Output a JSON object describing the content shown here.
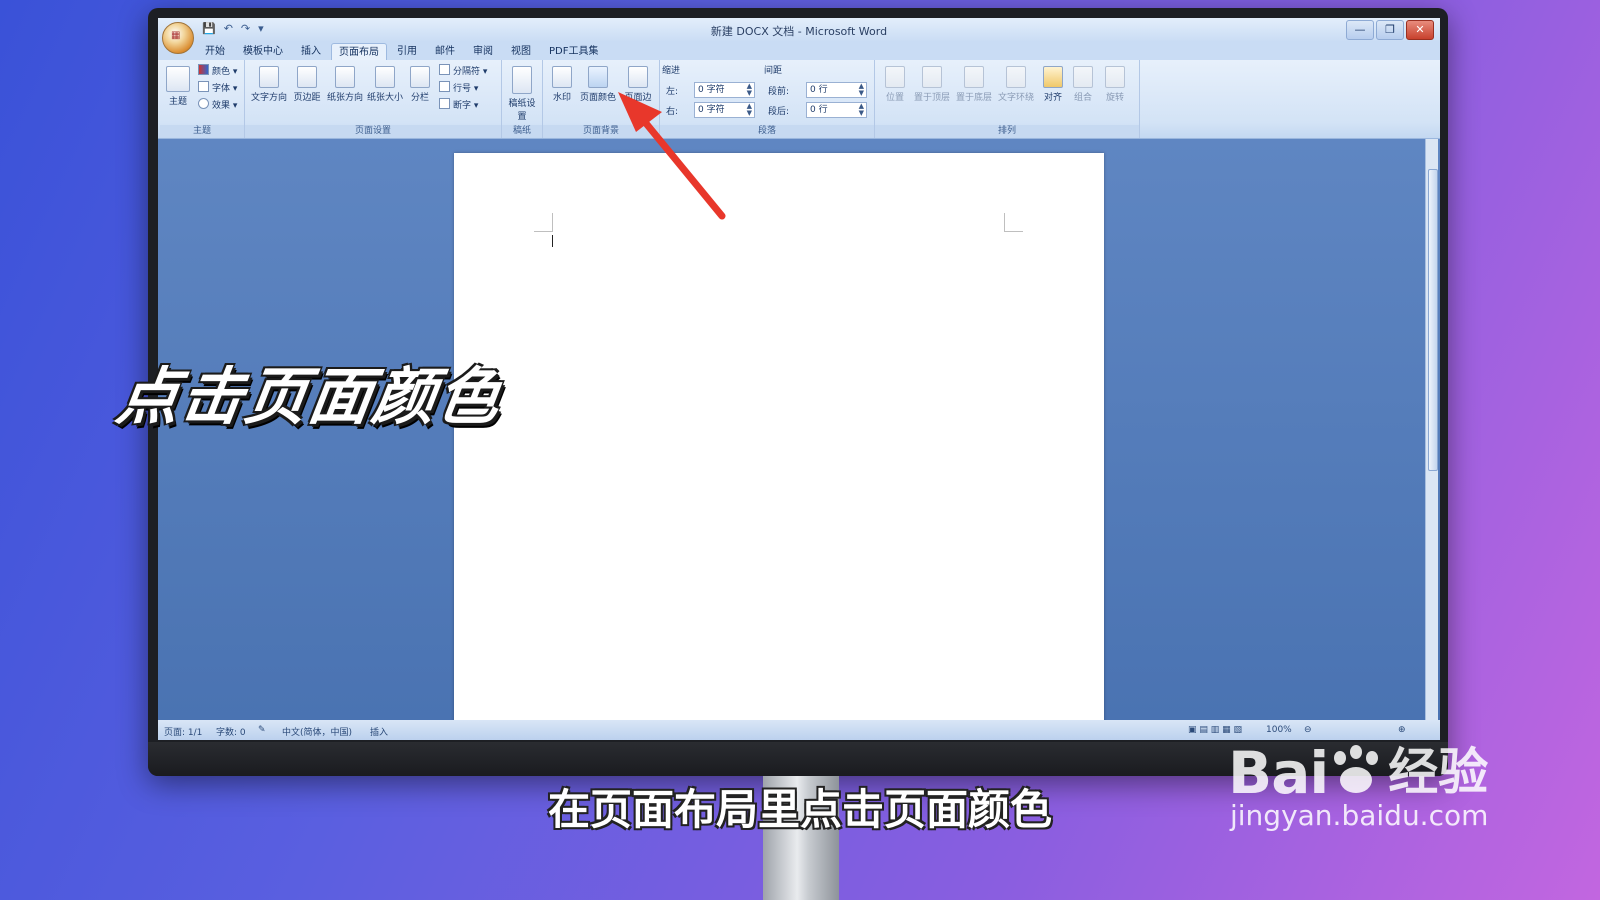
{
  "window": {
    "title": "新建 DOCX 文档 - Microsoft Word",
    "controls": [
      "—",
      "❐",
      "✕"
    ]
  },
  "tabs": [
    "开始",
    "模板中心",
    "插入",
    "页面布局",
    "引用",
    "邮件",
    "审阅",
    "视图",
    "PDF工具集"
  ],
  "active_tab": "页面布局",
  "ribbon": {
    "theme_group": {
      "label": "主题",
      "theme_button": "主题",
      "items": [
        "颜色",
        "字体",
        "效果"
      ]
    },
    "page_setup_group": {
      "label": "页面设置",
      "buttons": [
        "文字方向",
        "页边距",
        "纸张方向",
        "纸张大小",
        "分栏"
      ],
      "items": [
        "分隔符",
        "行号",
        "断字"
      ]
    },
    "draft_group": {
      "label": "稿纸",
      "button": "稿纸设置"
    },
    "background_group": {
      "label": "页面背景",
      "buttons": [
        "水印",
        "页面颜色",
        "页面边框"
      ]
    },
    "paragraph_group": {
      "label": "段落",
      "indent_title": "缩进",
      "spacing_title": "间距",
      "indent_left_label": "左:",
      "indent_left_value": "0 字符",
      "indent_right_label": "右:",
      "indent_right_value": "0 字符",
      "spacing_before_label": "段前:",
      "spacing_before_value": "0 行",
      "spacing_after_label": "段后:",
      "spacing_after_value": "0 行"
    },
    "arrange_group": {
      "label": "排列",
      "buttons": [
        "位置",
        "置于顶层",
        "置于底层",
        "文字环绕",
        "对齐",
        "组合",
        "旋转"
      ]
    }
  },
  "statusbar": {
    "page": "页面: 1/1",
    "words": "字数: 0",
    "language": "中文(简体，中国)",
    "mode": "插入",
    "zoom": "100%"
  },
  "overlay": {
    "caption": "点击页面颜色",
    "subtitle": "在页面布局里点击页面颜色",
    "watermark_brand": "Bai",
    "watermark_brand2": "经验",
    "watermark_url": "jingyan.baidu.com"
  },
  "colors": {
    "arrow": "#e8372b",
    "ribbon_bg": "#dbe8f8",
    "doc_bg": "#4f78b5"
  }
}
